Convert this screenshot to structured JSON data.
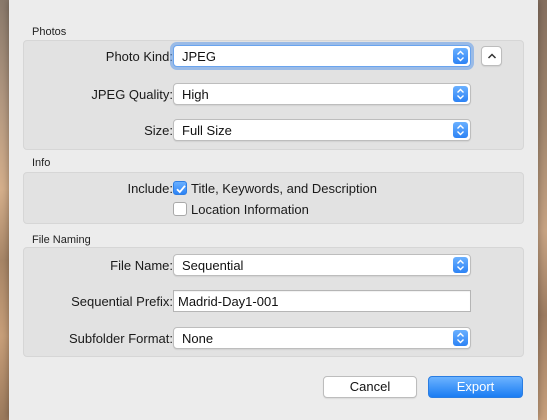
{
  "photos": {
    "section_title": "Photos",
    "photo_kind": {
      "label": "Photo Kind:",
      "value": "JPEG"
    },
    "jpeg_quality": {
      "label": "JPEG Quality:",
      "value": "High"
    },
    "size": {
      "label": "Size:",
      "value": "Full Size"
    }
  },
  "info": {
    "section_title": "Info",
    "include_label": "Include:",
    "options": [
      {
        "label": "Title, Keywords, and Description",
        "checked": true
      },
      {
        "label": "Location Information",
        "checked": false
      }
    ]
  },
  "file_naming": {
    "section_title": "File Naming",
    "file_name": {
      "label": "File Name:",
      "value": "Sequential"
    },
    "sequential_prefix": {
      "label": "Sequential Prefix:",
      "value": "Madrid-Day1-001"
    },
    "subfolder_format": {
      "label": "Subfolder Format:",
      "value": "None"
    }
  },
  "buttons": {
    "cancel": "Cancel",
    "export": "Export"
  },
  "colors": {
    "accent": "#2d83f5",
    "sheet_bg": "#ececec",
    "group_bg": "#e2e2e2"
  },
  "icons": {
    "stepper": "up-down-chevrons-icon",
    "disclosure": "chevron-up-icon",
    "checkmark": "checkmark-icon"
  }
}
